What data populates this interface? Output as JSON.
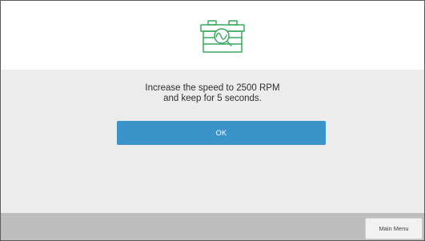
{
  "header": {
    "icon": "battery-search-icon",
    "icon_color": "#3aaa5e"
  },
  "dialog": {
    "message_line1": "Increase the speed to 2500 RPM",
    "message_line2": "and keep for 5 seconds.",
    "ok_label": "OK",
    "button_color": "#3a94c9"
  },
  "footer": {
    "main_menu_label": "Main Menu"
  }
}
